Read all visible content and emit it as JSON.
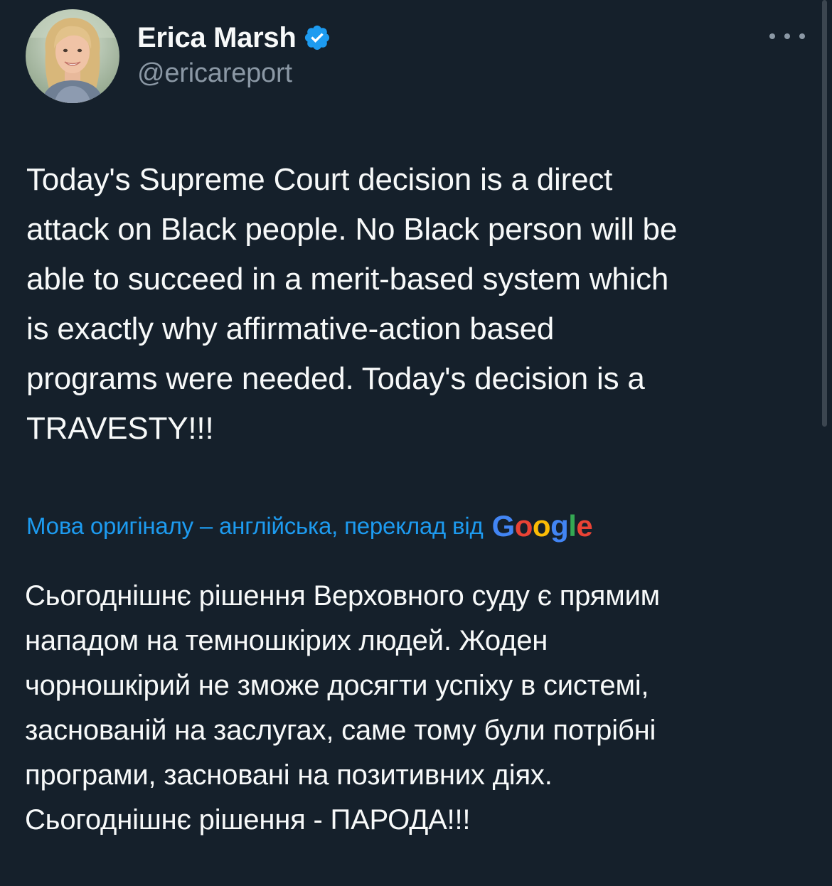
{
  "author": {
    "display_name": "Erica Marsh",
    "handle": "@ericareport",
    "verified": true,
    "verified_color": "#1d9bf0"
  },
  "menu": {
    "icon": "more-horizontal-icon"
  },
  "tweet": {
    "text": "Today's Supreme Court decision is a direct\nattack on Black people. No Black person will be\nable to succeed in a merit-based system which\nis exactly why affirmative-action based\nprograms were needed. Today's decision is a\nTRAVESTY!!!"
  },
  "translation": {
    "credit_label": "Мова оригіналу – англійська, переклад від",
    "provider": "Google",
    "text": "Сьогоднішнє рішення Верховного суду є прямим\nнападом на темношкірих людей. Жоден\nчорношкірий не зможе досягти успіху в системі,\nзаснованій на заслугах, саме тому були потрібні\nпрограми, засновані на позитивних діях.\nСьогоднішнє рішення - ПАРОДА!!!"
  },
  "colors": {
    "background": "#15202b",
    "text": "#f7f9f9",
    "secondary_text": "#8b98a5",
    "link": "#1d9bf0"
  }
}
